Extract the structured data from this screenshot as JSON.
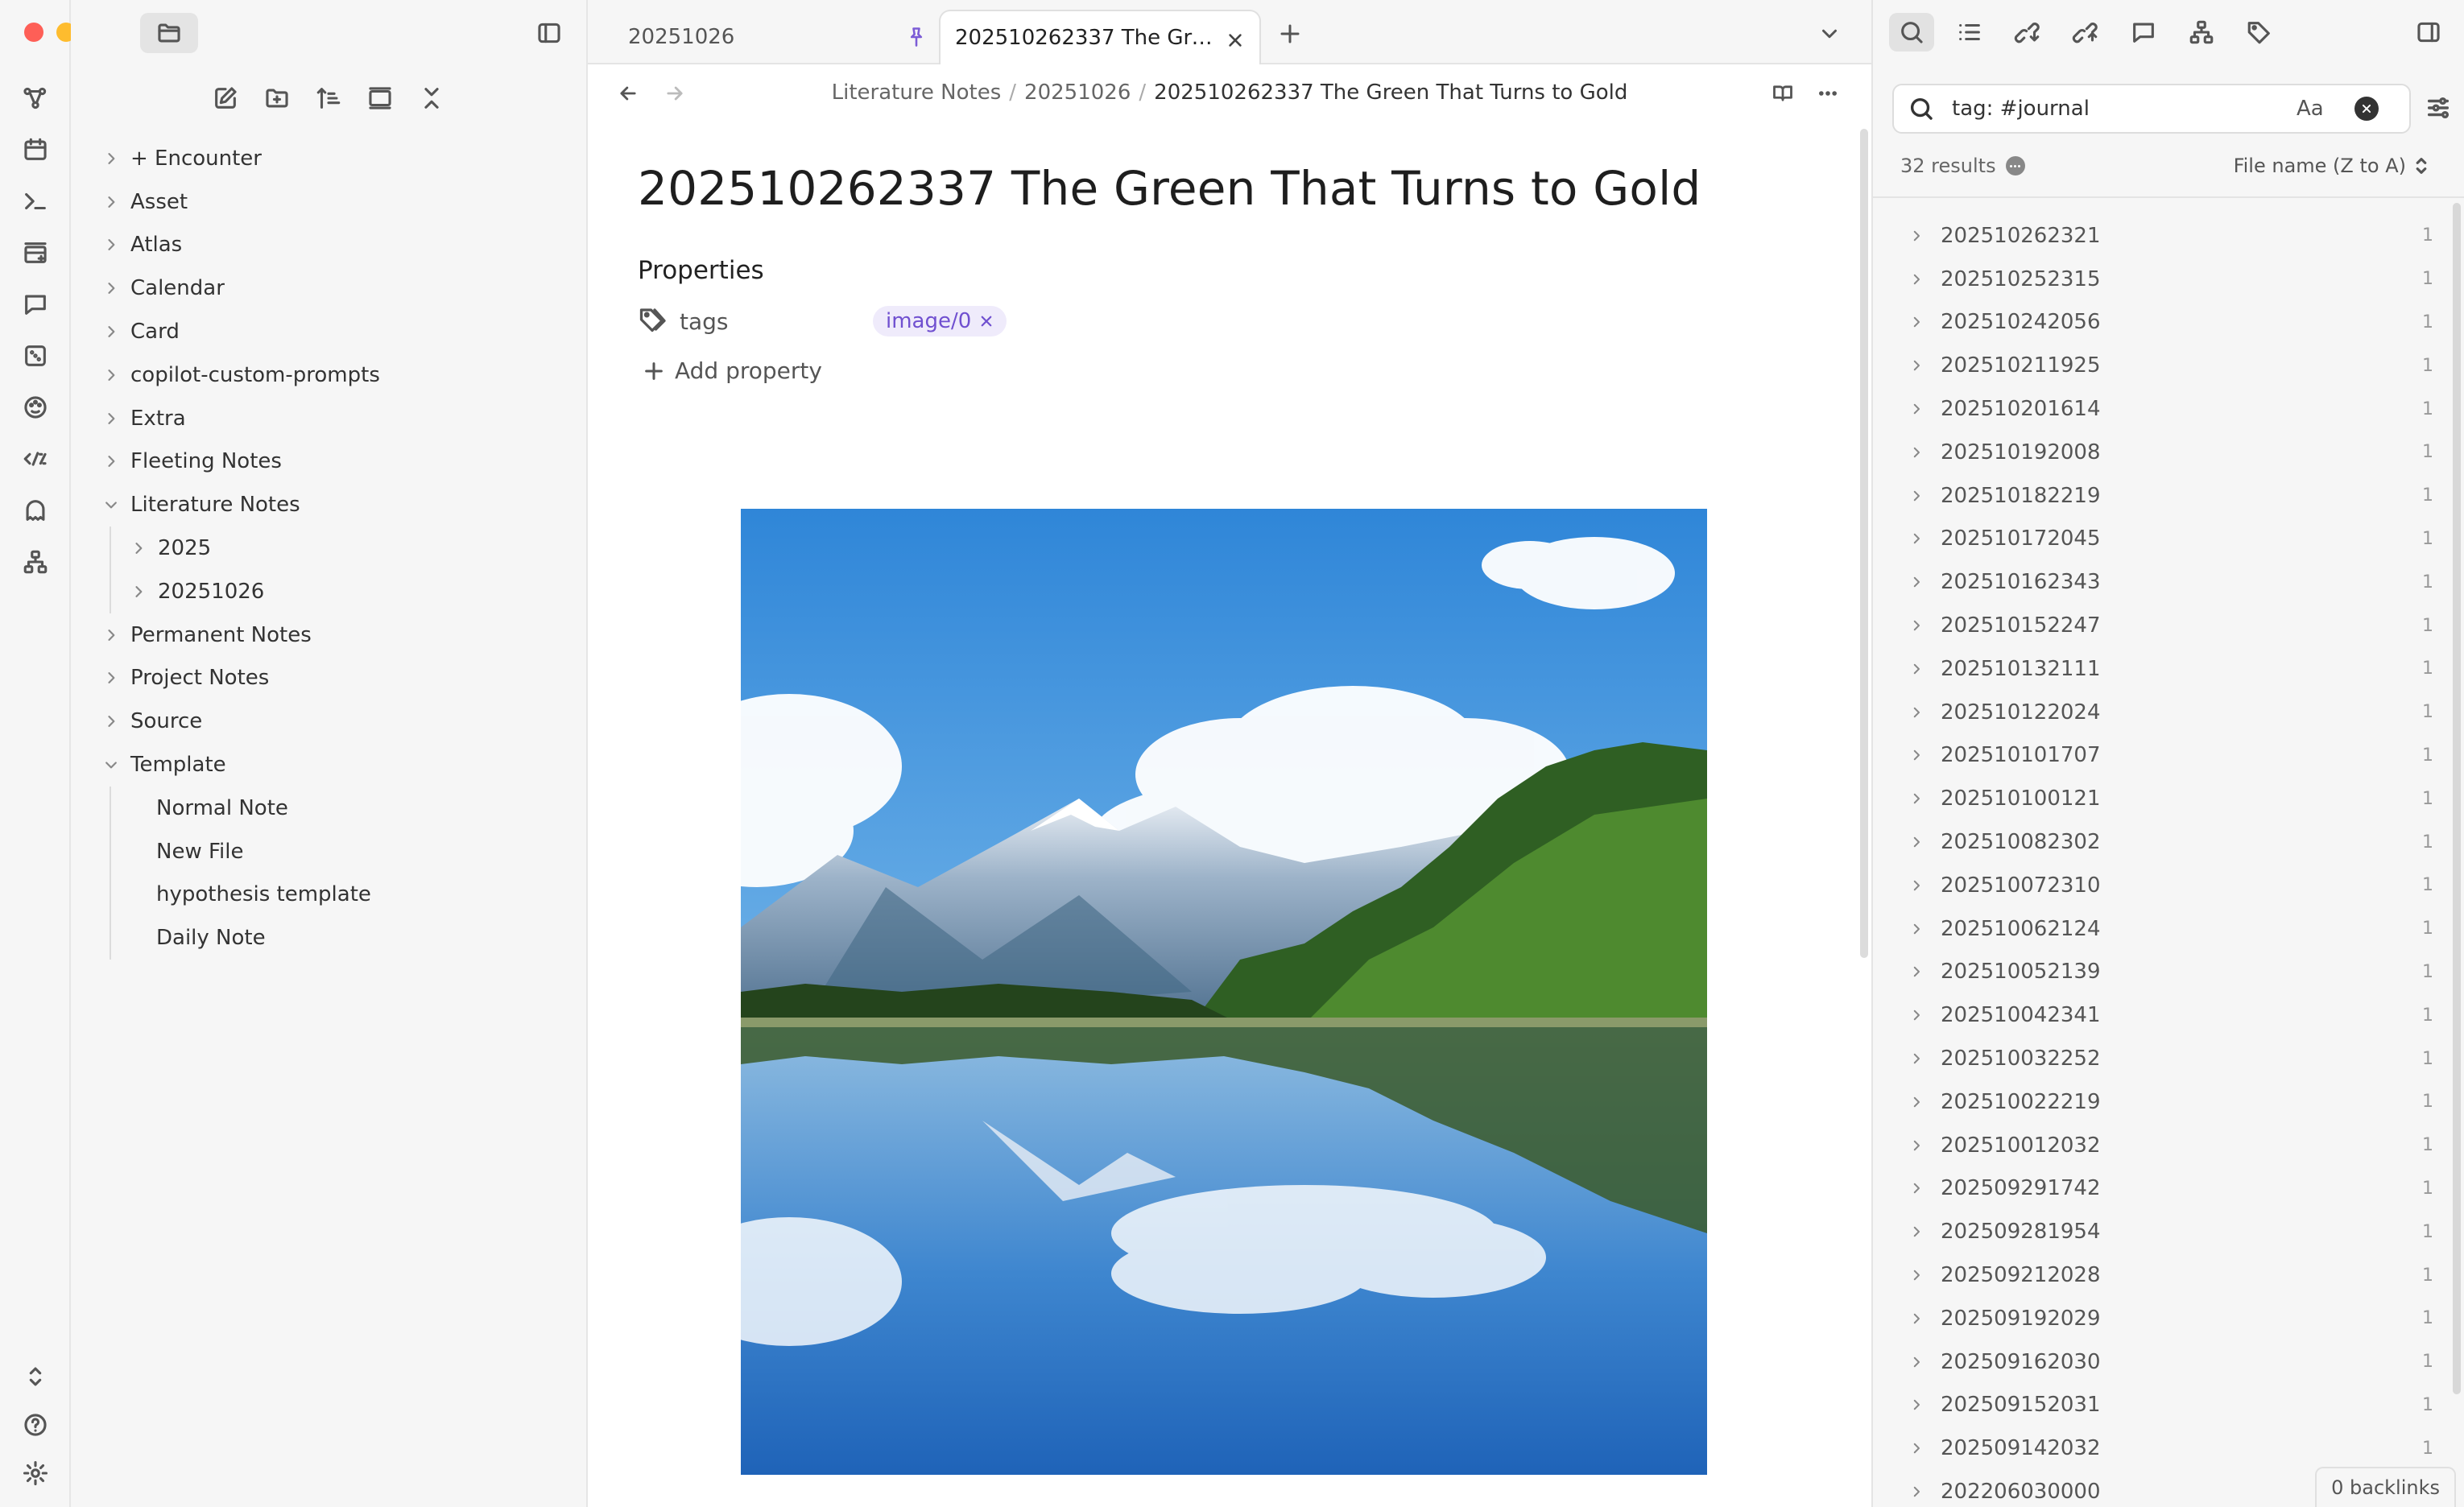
{
  "window": {
    "traffic_lights": [
      "#fe5f57",
      "#febc2e",
      "#28c840"
    ]
  },
  "ribbon": {
    "icons": [
      "graph-icon",
      "calendar-icon",
      "terminal-icon",
      "kanban-icon",
      "chat-icon",
      "dice-icon",
      "palette-icon",
      "templater-icon",
      "ghost-icon",
      "sitemap-icon"
    ],
    "bottom_icons": [
      "vault-switch-icon",
      "help-icon",
      "settings-icon"
    ]
  },
  "explorer": {
    "tree": [
      {
        "label": "+ Encounter",
        "type": "folder",
        "expanded": false,
        "level": 0
      },
      {
        "label": "Asset",
        "type": "folder",
        "expanded": false,
        "level": 0
      },
      {
        "label": "Atlas",
        "type": "folder",
        "expanded": false,
        "level": 0
      },
      {
        "label": "Calendar",
        "type": "folder",
        "expanded": false,
        "level": 0
      },
      {
        "label": "Card",
        "type": "folder",
        "expanded": false,
        "level": 0
      },
      {
        "label": "copilot-custom-prompts",
        "type": "folder",
        "expanded": false,
        "level": 0
      },
      {
        "label": "Extra",
        "type": "folder",
        "expanded": false,
        "level": 0
      },
      {
        "label": "Fleeting Notes",
        "type": "folder",
        "expanded": false,
        "level": 0
      },
      {
        "label": "Literature Notes",
        "type": "folder",
        "expanded": true,
        "level": 0
      },
      {
        "label": "2025",
        "type": "folder",
        "expanded": false,
        "level": 1
      },
      {
        "label": "20251026",
        "type": "folder",
        "expanded": false,
        "level": 1
      },
      {
        "label": "Permanent Notes",
        "type": "folder",
        "expanded": false,
        "level": 0
      },
      {
        "label": "Project Notes",
        "type": "folder",
        "expanded": false,
        "level": 0
      },
      {
        "label": "Source",
        "type": "folder",
        "expanded": false,
        "level": 0
      },
      {
        "label": "Template",
        "type": "folder",
        "expanded": true,
        "level": 0
      },
      {
        "label": "Normal Note",
        "type": "file",
        "level": 1
      },
      {
        "label": "New File",
        "type": "file",
        "level": 1
      },
      {
        "label": "hypothesis template",
        "type": "file",
        "level": 1
      },
      {
        "label": "Daily Note",
        "type": "file",
        "level": 1
      }
    ]
  },
  "tabs": [
    {
      "title": "20251026",
      "active": false,
      "pinned": true
    },
    {
      "title": "202510262337 The Green That Turns to Gold",
      "active": true
    }
  ],
  "breadcrumb": {
    "parts": [
      "Literature Notes",
      "20251026"
    ],
    "current": "202510262337 The Green That Turns to Gold"
  },
  "note": {
    "title": "202510262337 The Green That Turns to Gold",
    "properties_heading": "Properties",
    "property_key": "tags",
    "tag_value": "image/0",
    "add_property": "Add property"
  },
  "search": {
    "query": "tag: #journal",
    "match_case_label": "Aa",
    "results_count": "32 results",
    "sort": "File name (Z to A)",
    "results": [
      {
        "name": "202510262321",
        "count": "1"
      },
      {
        "name": "202510252315",
        "count": "1"
      },
      {
        "name": "202510242056",
        "count": "1"
      },
      {
        "name": "202510211925",
        "count": "1"
      },
      {
        "name": "202510201614",
        "count": "1"
      },
      {
        "name": "202510192008",
        "count": "1"
      },
      {
        "name": "202510182219",
        "count": "1"
      },
      {
        "name": "202510172045",
        "count": "1"
      },
      {
        "name": "202510162343",
        "count": "1"
      },
      {
        "name": "202510152247",
        "count": "1"
      },
      {
        "name": "202510132111",
        "count": "1"
      },
      {
        "name": "202510122024",
        "count": "1"
      },
      {
        "name": "202510101707",
        "count": "1"
      },
      {
        "name": "202510100121",
        "count": "1"
      },
      {
        "name": "202510082302",
        "count": "1"
      },
      {
        "name": "202510072310",
        "count": "1"
      },
      {
        "name": "202510062124",
        "count": "1"
      },
      {
        "name": "202510052139",
        "count": "1"
      },
      {
        "name": "202510042341",
        "count": "1"
      },
      {
        "name": "202510032252",
        "count": "1"
      },
      {
        "name": "202510022219",
        "count": "1"
      },
      {
        "name": "202510012032",
        "count": "1"
      },
      {
        "name": "202509291742",
        "count": "1"
      },
      {
        "name": "202509281954",
        "count": "1"
      },
      {
        "name": "202509212028",
        "count": "1"
      },
      {
        "name": "202509192029",
        "count": "1"
      },
      {
        "name": "202509162030",
        "count": "1"
      },
      {
        "name": "202509152031",
        "count": "1"
      },
      {
        "name": "202509142032",
        "count": "1"
      },
      {
        "name": "202206030000",
        "count": ""
      }
    ]
  },
  "status": {
    "backlinks": "0 backlinks"
  },
  "colors": {
    "accent": "#7c5cd6",
    "tag_bg": "#efebfb"
  }
}
